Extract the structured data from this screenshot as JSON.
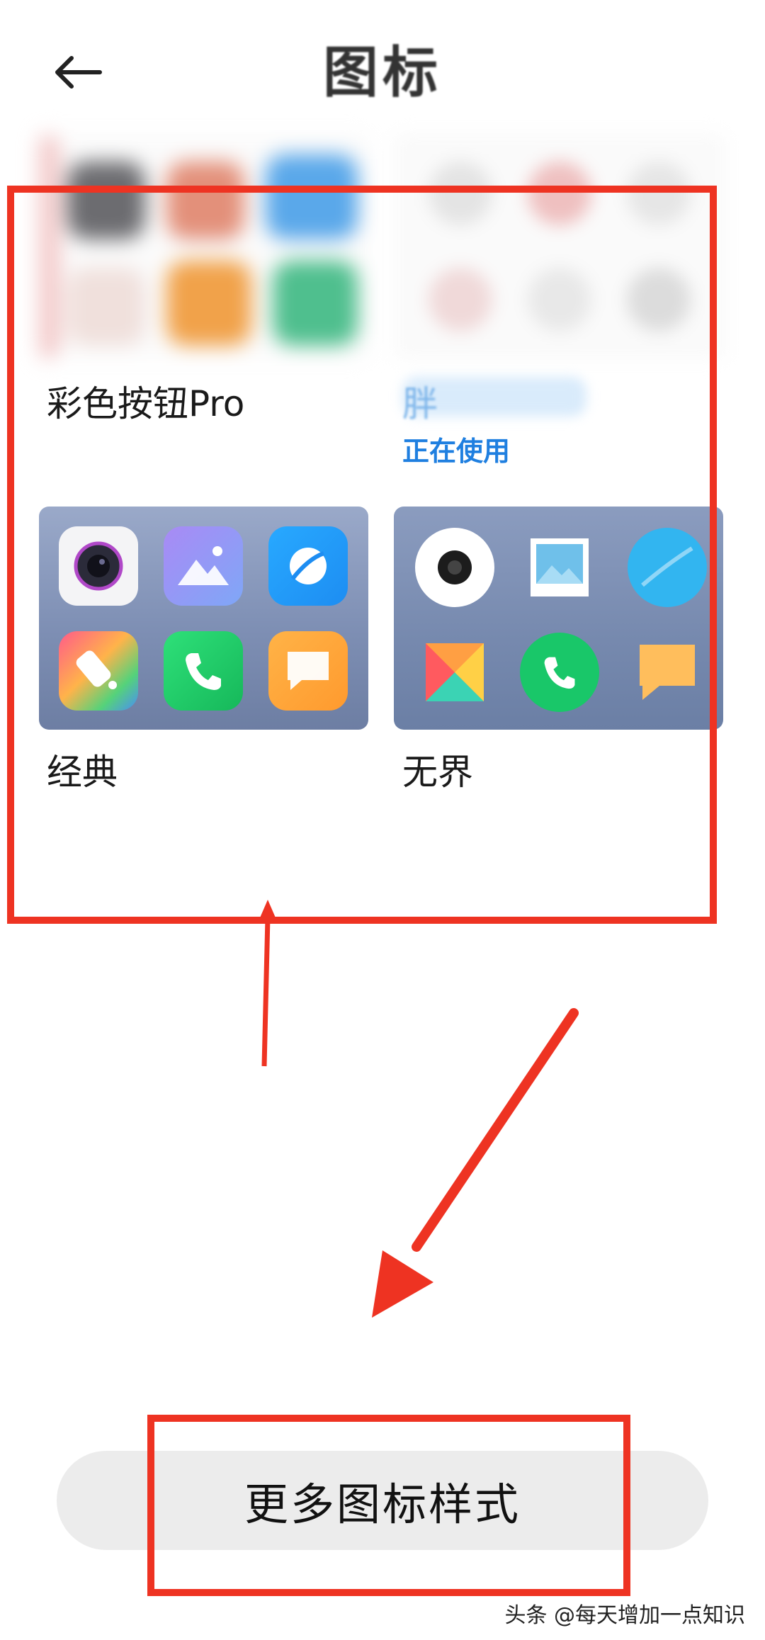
{
  "header": {
    "title": "图标"
  },
  "themes": [
    {
      "name": "彩色按钮Pro"
    },
    {
      "name": "胖",
      "status": "正在使用"
    },
    {
      "name": "经典"
    },
    {
      "name": "无界"
    }
  ],
  "more_button_label": "更多图标样式",
  "watermark": "头条 @每天增加一点知识",
  "colors": {
    "accent": "#1f7fe0",
    "annotation_red": "#ee3322",
    "button_bg": "#ececec"
  }
}
